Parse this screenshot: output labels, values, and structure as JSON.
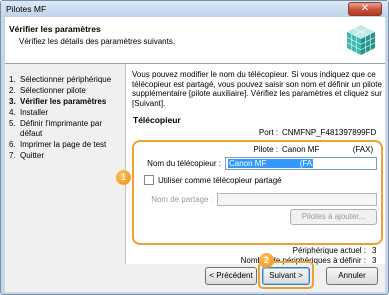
{
  "window": {
    "title": "Pilotes MF",
    "close_glyph": "✕"
  },
  "header": {
    "title": "Vérifier les paramètres",
    "subtitle": "Vérifiez les détails des paramètres suivants."
  },
  "steps": [
    {
      "num": "1.",
      "label": "Sélectionner périphérique"
    },
    {
      "num": "2.",
      "label": "Sélectionner pilote"
    },
    {
      "num": "3.",
      "label": "Vérifier les paramètres",
      "current": true
    },
    {
      "num": "4.",
      "label": "Installer"
    },
    {
      "num": "5.",
      "label": "Définir l'imprimante par défaut"
    },
    {
      "num": "6.",
      "label": "Imprimer la page de test"
    },
    {
      "num": "7.",
      "label": "Quitter"
    }
  ],
  "panel": {
    "intro": "Vous pouvez modifier le nom du télécopieur. Si vous indiquez que ce télécopieur est partagé, vous pouvez saisir son nom et définir un pilote supplémentaire [pilote auxiliaire]. Vérifiez les paramètres et cliquez sur [Suivant].",
    "section_title": "Télécopieur",
    "port_label": "Port :",
    "port_value": "CNMFNP_F481397899FD",
    "driver_label": "Pilote :",
    "driver_value": "Canon MF               (FAX)",
    "fax_name_label": "Nom du télécopieur :",
    "fax_name_value": "Canon MF               (FAX)",
    "share_label": "Utiliser comme télécopieur partagé",
    "share_name_label": "Nom de partage :",
    "share_name_value": "",
    "add_drivers_label": "Pilotes à ajouter...",
    "current_device_label": "Périphérique actuel :",
    "current_device_value": "3",
    "devices_to_define_label": "Nombre de périphériques à définir :",
    "devices_to_define_value": "3"
  },
  "footer": {
    "back_label": "< Précédent",
    "next_label": "Suivant >",
    "cancel_label": "Annuler"
  },
  "callouts": {
    "one": "1",
    "two": "2"
  },
  "colors": {
    "highlight": "#f0a030",
    "selection": "#3399ff"
  }
}
